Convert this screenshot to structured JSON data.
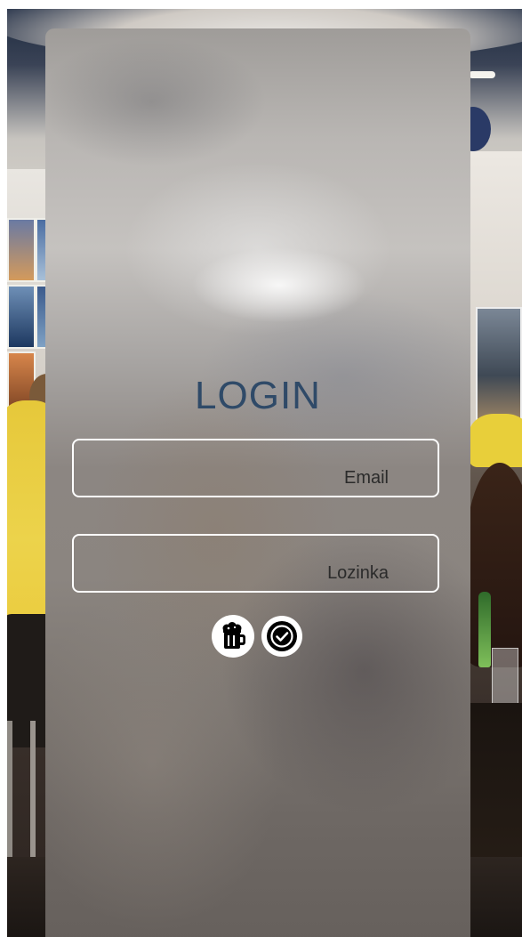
{
  "login": {
    "title": "LOGIN",
    "email": {
      "label": "Email",
      "value": ""
    },
    "password": {
      "label": "Lozinka",
      "value": ""
    },
    "actions": {
      "beer_icon": "beer-mug-icon",
      "confirm_icon": "check-circle-icon"
    }
  },
  "colors": {
    "title": "#2f4a68",
    "field_border": "#ffffff",
    "label": "#2b2b2b",
    "icon_bg": "#ffffff",
    "icon_fg": "#000000"
  }
}
